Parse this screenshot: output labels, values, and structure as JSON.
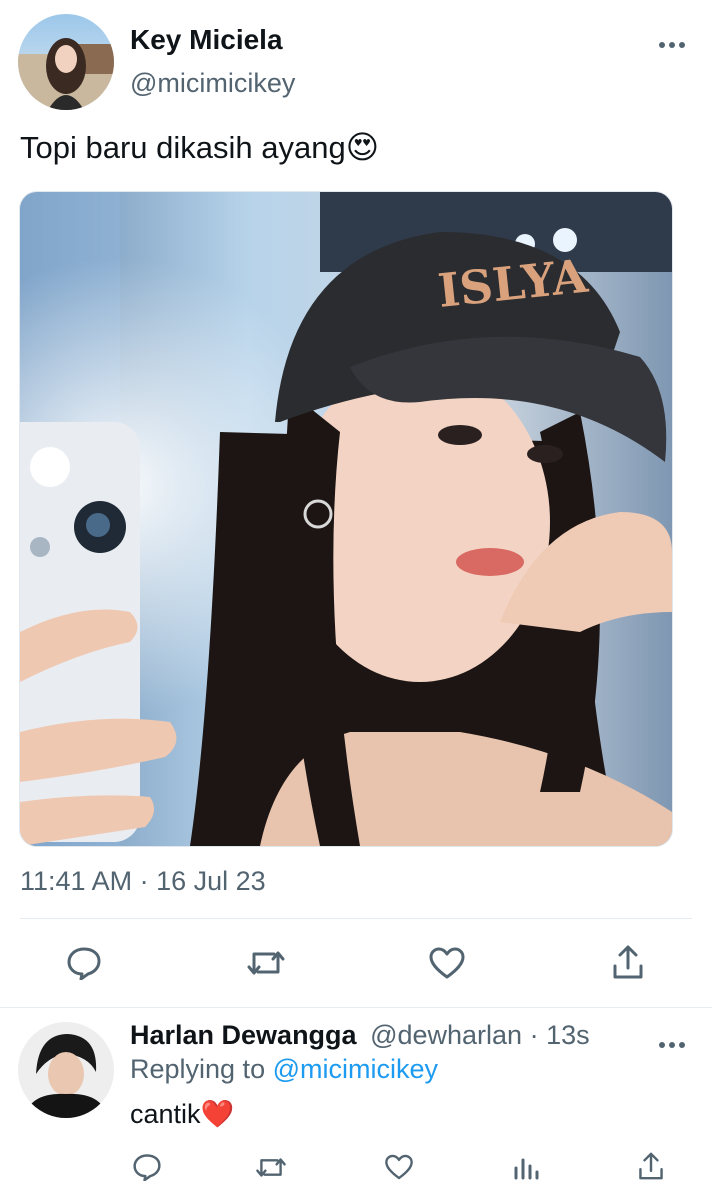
{
  "tweet": {
    "author": {
      "name": "Key Miciela",
      "handle": "@micimicikey"
    },
    "text": "Topi baru dikasih ayang",
    "emoji": "😍",
    "timestamp": "11:41 AM · 16 Jul 23",
    "more_icon": "more-horizontal-icon",
    "photo": {
      "cap_text": "ISLYA"
    },
    "actions": [
      "reply-icon",
      "retweet-icon",
      "like-icon",
      "share-icon"
    ]
  },
  "reply": {
    "author": {
      "name": "Harlan Dewangga",
      "handle": "@dewharlan",
      "time": "· 13s"
    },
    "replying_prefix": "Replying to",
    "replying_handle": "@micimicikey",
    "text": "cantik",
    "emoji": "❤️",
    "actions": [
      "reply-icon",
      "retweet-icon",
      "like-icon",
      "analytics-icon",
      "share-icon"
    ]
  },
  "colors": {
    "accent": "#1d9bf0",
    "secondary_text": "#536471",
    "divider": "#e6ecf0"
  }
}
